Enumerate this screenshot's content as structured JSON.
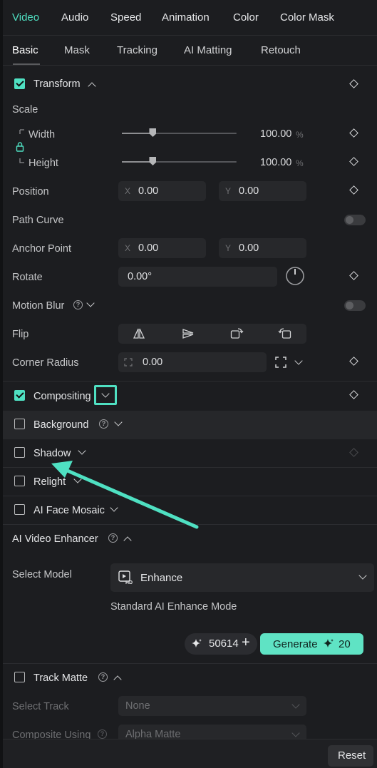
{
  "main_tabs": [
    "Video",
    "Audio",
    "Speed",
    "Animation",
    "Color",
    "Color Mask"
  ],
  "sub_tabs": [
    "Basic",
    "Mask",
    "Tracking",
    "AI Matting",
    "Retouch"
  ],
  "transform": {
    "title": "Transform",
    "checked": true,
    "scale_label": "Scale",
    "width_label": "Width",
    "width_value": "100.00",
    "height_label": "Height",
    "height_value": "100.00",
    "scale_unit": "%",
    "scale_level_fraction": 0.27,
    "position_label": "Position",
    "position_x": "0.00",
    "position_y": "0.00",
    "axis_x": "X",
    "axis_y": "Y",
    "path_curve_label": "Path Curve",
    "anchor_label": "Anchor Point",
    "anchor_x": "0.00",
    "anchor_y": "0.00",
    "rotate_label": "Rotate",
    "rotate_value": "0.00°",
    "motion_blur_label": "Motion Blur",
    "flip_label": "Flip",
    "corner_radius_label": "Corner Radius",
    "corner_radius_value": "0.00"
  },
  "sections": {
    "compositing": "Compositing",
    "background": "Background",
    "shadow": "Shadow",
    "relight": "Relight",
    "face_mosaic": "AI Face Mosaic"
  },
  "enhancer": {
    "title": "AI Video Enhancer",
    "select_model_label": "Select Model",
    "model_value": "Enhance",
    "mode_description": "Standard AI Enhance Mode",
    "credits": "50614",
    "generate_label": "Generate",
    "generate_cost": "20"
  },
  "track_matte": {
    "title": "Track Matte",
    "select_track_label": "Select Track",
    "select_track_value": "None",
    "composite_label": "Composite Using",
    "composite_value": "Alpha Matte"
  },
  "footer": {
    "reset_label": "Reset"
  },
  "colors": {
    "accent": "#4fe0c2",
    "background": "#1c1d20"
  }
}
